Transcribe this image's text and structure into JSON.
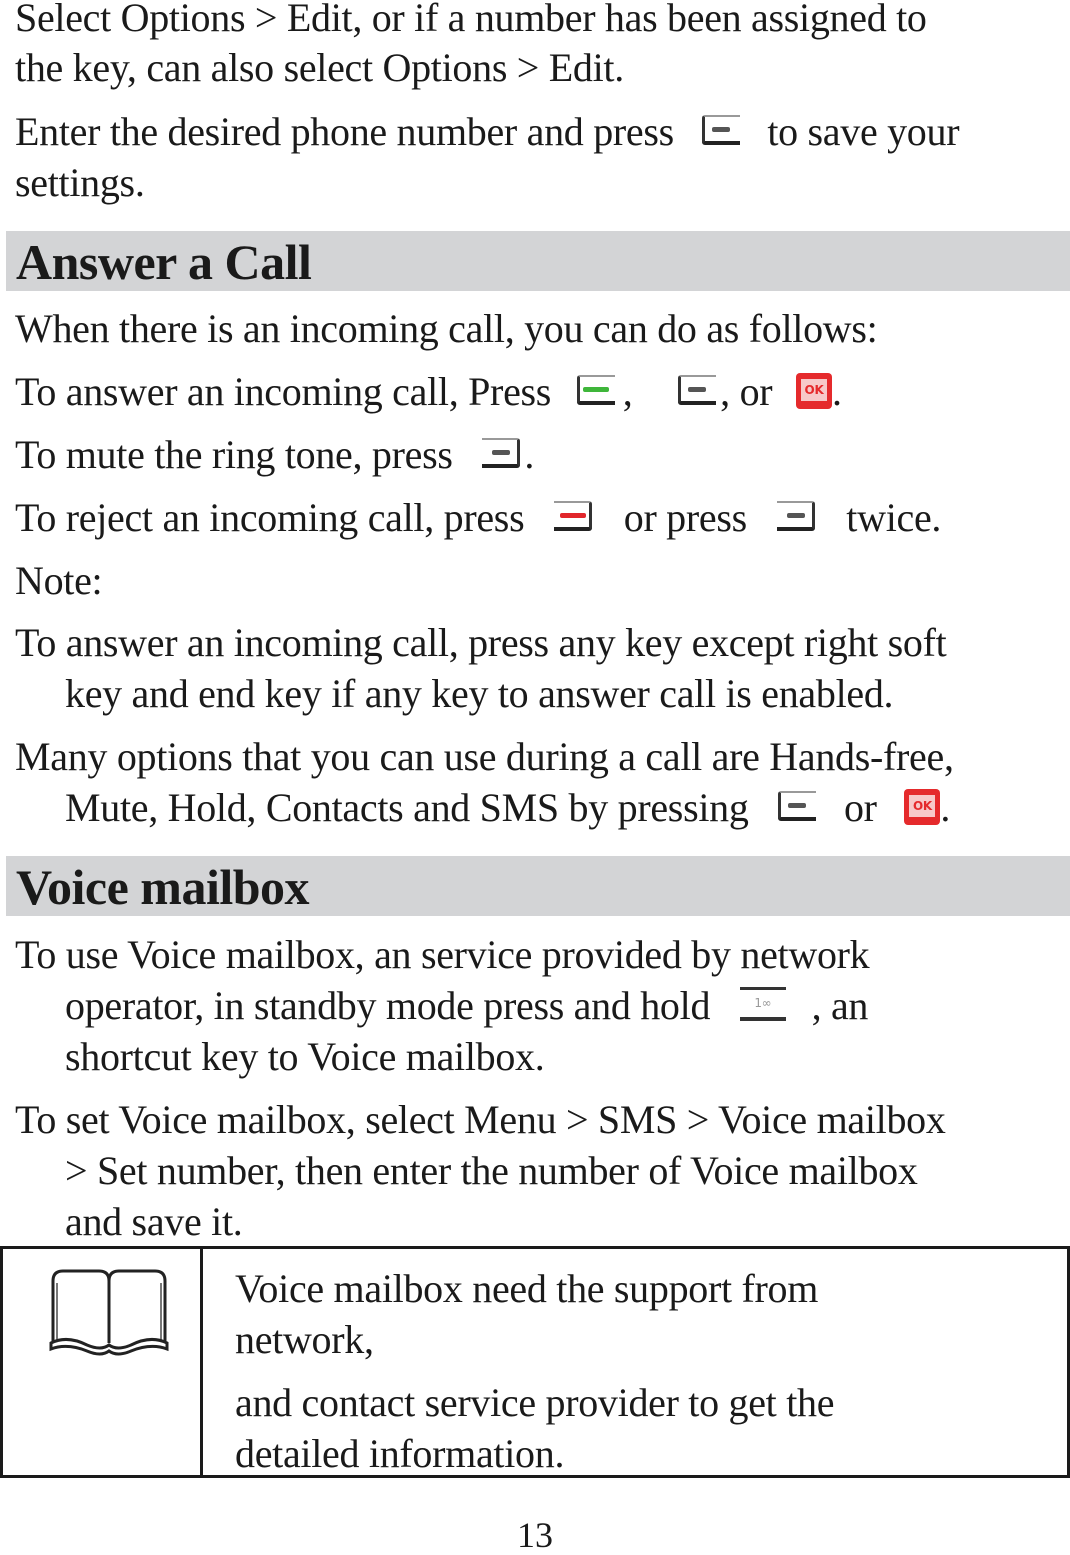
{
  "intro": {
    "p1_line1": "Select Options > Edit, or if a number has been assigned to",
    "p1_line2": "the key, can also select Options > Edit.",
    "p2_before": "Enter the desired phone number and press",
    "p2_after": "to save your",
    "p2_line2": "settings."
  },
  "answer_section": {
    "heading": "Answer a Call",
    "intro": "When there is an incoming call, you can do as follows:",
    "answer_before": "To answer an incoming call, Press",
    "answer_sep1": ",",
    "answer_sep2": ", or",
    "answer_end": ".",
    "mute_before": "To mute the ring tone, press",
    "mute_end": ".",
    "reject_before": "To reject an incoming call, press",
    "reject_mid": "or press",
    "reject_after": "twice.",
    "note_label": "Note:",
    "note1_line1": "To answer an incoming call, press any key except right soft",
    "note1_line2": "key and end key if any key to answer call is enabled.",
    "note2_line1": "Many options that you can use during a call are Hands-free,",
    "note2_line2_before": "Mute, Hold, Contacts and SMS by pressing",
    "note2_mid": "or",
    "note2_end": "."
  },
  "voicemail_section": {
    "heading": "Voice mailbox",
    "use_line1": "To use Voice mailbox, an service provided by network",
    "use_line2_before": "operator, in standby mode press and hold",
    "use_line2_after": ", an",
    "use_line3": "shortcut key to Voice mailbox.",
    "set_line1": "To set Voice mailbox, select Menu > SMS > Voice mailbox",
    "set_line2": "> Set number, then enter the number of Voice mailbox",
    "set_line3": "and save it."
  },
  "note_box": {
    "icon": "book-icon",
    "line1": "Voice mailbox need the support from",
    "line2": "network,",
    "line3": "and contact service provider to get the",
    "line4": "detailed information."
  },
  "icons": {
    "left_soft_key": "left-soft-key-icon",
    "right_soft_key": "right-soft-key-icon",
    "send_key": "send-key-icon",
    "end_key": "end-key-icon",
    "ok_key": "ok-key-icon",
    "ok_label": "OK",
    "one_key": "one-key-voicemail-icon",
    "one_key_label": "1∞"
  },
  "colors": {
    "heading_band": "#d3d4d6",
    "send_green": "#3fb63a",
    "end_red": "#e1262b",
    "ok_red": "#e52a2c"
  },
  "footer": {
    "page_number": "13"
  }
}
